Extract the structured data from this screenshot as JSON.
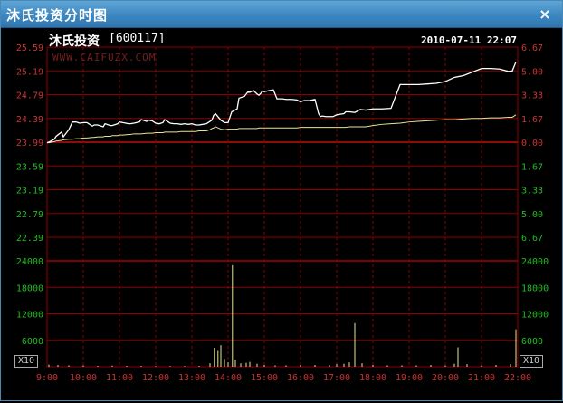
{
  "window": {
    "title": "沐氏投资分时图",
    "close_label": "×"
  },
  "header": {
    "stock_name": "沐氏投资",
    "stock_code": "[600117]",
    "watermark": "WWW.CAIFUZX.COM",
    "timestamp": "2010-07-11 22:07"
  },
  "volume_multiplier": "X10",
  "colors": {
    "grid": "#8b0000",
    "price": "#ffffff",
    "average": "#e6e69a",
    "up_label": "#cc3333",
    "down_label": "#22bb22",
    "volume": "#e6e68a",
    "time_label": "#cc3333"
  },
  "chart_data": {
    "type": "line",
    "price_axis": {
      "labels": [
        "25.59",
        "25.19",
        "24.79",
        "24.39",
        "23.99",
        "23.59",
        "23.19",
        "22.79",
        "22.39"
      ],
      "percent_labels": [
        "6.67",
        "5.00",
        "3.33",
        "1.67",
        "0.00",
        "1.67",
        "3.33",
        "5.00",
        "6.67"
      ],
      "ylim": [
        22.39,
        25.59
      ],
      "base": 23.99
    },
    "volume_axis": {
      "labels": [
        "24000",
        "18000",
        "12000",
        "6000"
      ],
      "ylim": [
        0,
        24000
      ]
    },
    "time_labels": [
      "9:00",
      "10:00",
      "11:00",
      "12:00",
      "13:00",
      "14:00",
      "15:00",
      "16:00",
      "17:00",
      "18:00",
      "19:00",
      "20:00",
      "21:00",
      "22:00"
    ],
    "x": [
      0,
      0.05,
      0.2,
      0.25,
      0.4,
      0.45,
      0.6,
      0.7,
      0.8,
      0.9,
      1.0,
      1.1,
      1.25,
      1.3,
      1.4,
      1.55,
      1.6,
      1.75,
      1.8,
      1.95,
      2.0,
      2.1,
      2.25,
      2.3,
      2.4,
      2.55,
      2.6,
      2.75,
      2.8,
      2.9,
      3.0,
      3.1,
      3.2,
      3.25,
      3.4,
      3.5,
      3.6,
      3.7,
      3.8,
      3.9,
      4.0,
      4.1,
      4.2,
      4.3,
      4.4,
      4.5,
      4.55,
      4.6,
      4.65,
      4.8,
      4.9,
      5.0,
      5.1,
      5.25,
      5.3,
      5.45,
      5.55,
      5.6,
      5.7,
      5.8,
      5.85,
      5.9,
      5.95,
      6.0,
      6.15,
      6.25,
      6.35,
      6.5,
      6.6,
      6.75,
      6.9,
      7.0,
      7.1,
      7.25,
      7.4,
      7.5,
      7.55,
      7.6,
      7.7,
      7.8,
      7.9,
      8.0,
      8.1,
      8.2,
      8.25,
      8.35,
      8.5,
      8.65,
      8.8,
      9.0,
      9.25,
      9.5,
      9.75,
      10.0,
      10.25,
      10.5,
      10.75,
      11.0,
      11.25,
      11.5,
      11.75,
      12.0,
      12.25,
      12.5,
      12.75,
      12.85,
      12.95
    ],
    "series": [
      {
        "values": [
          23.98,
          23.99,
          24.04,
          24.09,
          24.16,
          24.08,
          24.2,
          24.33,
          24.33,
          24.31,
          24.32,
          24.32,
          24.26,
          24.28,
          24.28,
          24.25,
          24.3,
          24.27,
          24.27,
          24.3,
          24.33,
          24.32,
          24.3,
          24.3,
          24.31,
          24.33,
          24.37,
          24.34,
          24.36,
          24.35,
          24.31,
          24.3,
          24.32,
          24.37,
          24.31,
          24.3,
          24.3,
          24.29,
          24.3,
          24.29,
          24.3,
          24.28,
          24.28,
          24.29,
          24.3,
          24.34,
          24.36,
          24.44,
          24.47,
          24.36,
          24.32,
          24.32,
          24.5,
          24.55,
          24.73,
          24.76,
          24.84,
          24.83,
          24.86,
          24.8,
          24.78,
          24.81,
          24.85,
          24.84,
          24.86,
          24.87,
          24.72,
          24.72,
          24.71,
          24.71,
          24.7,
          24.67,
          24.69,
          24.69,
          24.71,
          24.47,
          24.42,
          24.43,
          24.42,
          24.42,
          24.42,
          24.45,
          24.46,
          24.47,
          24.5,
          24.5,
          24.49,
          24.54,
          24.53,
          24.55,
          24.55,
          24.56,
          24.96,
          24.96,
          24.96,
          24.97,
          24.98,
          25.01,
          25.08,
          25.11,
          25.17,
          25.23,
          25.23,
          25.22,
          25.18,
          25.19,
          25.34
        ]
      },
      {
        "values": [
          23.98,
          23.98,
          24.0,
          24.01,
          24.02,
          24.03,
          24.04,
          24.04,
          24.05,
          24.05,
          24.06,
          24.06,
          24.07,
          24.07,
          24.08,
          24.08,
          24.09,
          24.09,
          24.1,
          24.1,
          24.11,
          24.11,
          24.12,
          24.12,
          24.13,
          24.13,
          24.13,
          24.14,
          24.14,
          24.14,
          24.15,
          24.15,
          24.15,
          24.16,
          24.16,
          24.16,
          24.16,
          24.17,
          24.17,
          24.17,
          24.17,
          24.17,
          24.18,
          24.18,
          24.18,
          24.2,
          24.22,
          24.23,
          24.25,
          24.21,
          24.2,
          24.21,
          24.21,
          24.21,
          24.22,
          24.22,
          24.22,
          24.22,
          24.22,
          24.22,
          24.23,
          24.23,
          24.23,
          24.23,
          24.23,
          24.23,
          24.23,
          24.23,
          24.23,
          24.23,
          24.23,
          24.24,
          24.24,
          24.24,
          24.24,
          24.24,
          24.24,
          24.24,
          24.24,
          24.24,
          24.24,
          24.24,
          24.24,
          24.24,
          24.24,
          24.25,
          24.25,
          24.25,
          24.25,
          24.27,
          24.29,
          24.3,
          24.31,
          24.33,
          24.34,
          24.35,
          24.36,
          24.37,
          24.37,
          24.38,
          24.39,
          24.39,
          24.4,
          24.4,
          24.41,
          24.41,
          24.45
        ]
      }
    ],
    "volume_bars": [
      {
        "t": 0.05,
        "v": 500
      },
      {
        "t": 0.3,
        "v": 400
      },
      {
        "t": 0.6,
        "v": 300
      },
      {
        "t": 1.0,
        "v": 300
      },
      {
        "t": 1.4,
        "v": 200
      },
      {
        "t": 1.8,
        "v": 250
      },
      {
        "t": 2.2,
        "v": 200
      },
      {
        "t": 2.6,
        "v": 200
      },
      {
        "t": 3.0,
        "v": 150
      },
      {
        "t": 3.4,
        "v": 150
      },
      {
        "t": 3.8,
        "v": 150
      },
      {
        "t": 4.2,
        "v": 200
      },
      {
        "t": 4.5,
        "v": 800
      },
      {
        "t": 4.62,
        "v": 4300
      },
      {
        "t": 4.72,
        "v": 3600
      },
      {
        "t": 4.8,
        "v": 4900
      },
      {
        "t": 4.9,
        "v": 1800
      },
      {
        "t": 5.0,
        "v": 1000
      },
      {
        "t": 5.12,
        "v": 23000
      },
      {
        "t": 5.2,
        "v": 1600
      },
      {
        "t": 5.35,
        "v": 800
      },
      {
        "t": 5.5,
        "v": 900
      },
      {
        "t": 5.6,
        "v": 1100
      },
      {
        "t": 5.8,
        "v": 700
      },
      {
        "t": 6.0,
        "v": 400
      },
      {
        "t": 6.3,
        "v": 300
      },
      {
        "t": 6.6,
        "v": 300
      },
      {
        "t": 7.0,
        "v": 400
      },
      {
        "t": 7.4,
        "v": 400
      },
      {
        "t": 7.8,
        "v": 350
      },
      {
        "t": 8.0,
        "v": 600
      },
      {
        "t": 8.2,
        "v": 700
      },
      {
        "t": 8.35,
        "v": 1000
      },
      {
        "t": 8.5,
        "v": 9900
      },
      {
        "t": 8.7,
        "v": 800
      },
      {
        "t": 9.0,
        "v": 400
      },
      {
        "t": 9.4,
        "v": 300
      },
      {
        "t": 9.8,
        "v": 300
      },
      {
        "t": 10.2,
        "v": 300
      },
      {
        "t": 10.6,
        "v": 400
      },
      {
        "t": 11.0,
        "v": 300
      },
      {
        "t": 11.25,
        "v": 700
      },
      {
        "t": 11.35,
        "v": 4400
      },
      {
        "t": 11.6,
        "v": 600
      },
      {
        "t": 12.0,
        "v": 300
      },
      {
        "t": 12.4,
        "v": 400
      },
      {
        "t": 12.8,
        "v": 600
      },
      {
        "t": 12.95,
        "v": 8500
      }
    ]
  }
}
